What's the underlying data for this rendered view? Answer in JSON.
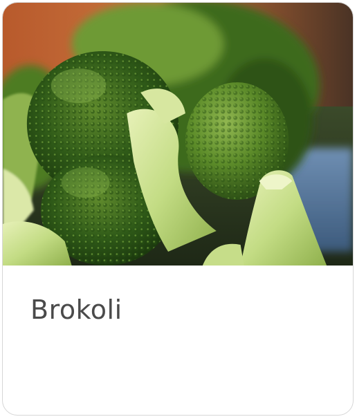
{
  "card": {
    "title": "Brokoli",
    "image_subject": "broccoli",
    "title_color": "#4a4a4a",
    "border_color": "#d6d6d6"
  }
}
